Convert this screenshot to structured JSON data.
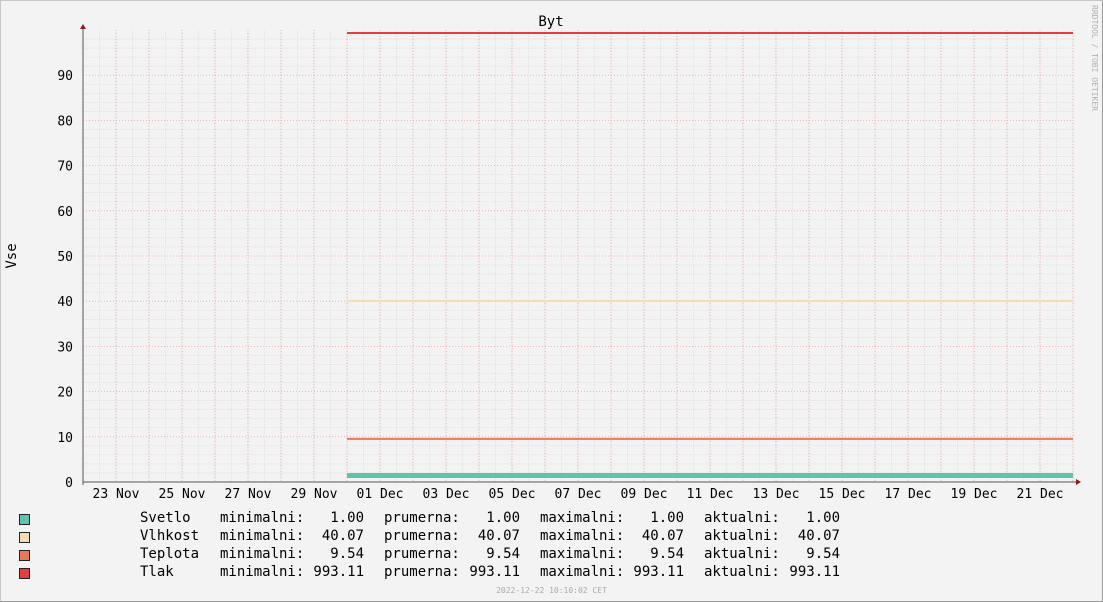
{
  "chart_data": {
    "type": "line",
    "title": "Byt",
    "ylabel": "Vse",
    "xlabel": "",
    "ylim": [
      0,
      100
    ],
    "yticks": [
      0,
      10,
      20,
      30,
      40,
      50,
      60,
      70,
      80,
      90
    ],
    "xlim": [
      "2022-11-22",
      "2022-12-22"
    ],
    "xticks": [
      {
        "date": "2022-11-23",
        "label": "23 Nov"
      },
      {
        "date": "2022-11-25",
        "label": "25 Nov"
      },
      {
        "date": "2022-11-27",
        "label": "27 Nov"
      },
      {
        "date": "2022-11-29",
        "label": "29 Nov"
      },
      {
        "date": "2022-12-01",
        "label": "01 Dec"
      },
      {
        "date": "2022-12-03",
        "label": "03 Dec"
      },
      {
        "date": "2022-12-05",
        "label": "05 Dec"
      },
      {
        "date": "2022-12-07",
        "label": "07 Dec"
      },
      {
        "date": "2022-12-09",
        "label": "09 Dec"
      },
      {
        "date": "2022-12-11",
        "label": "11 Dec"
      },
      {
        "date": "2022-12-13",
        "label": "13 Dec"
      },
      {
        "date": "2022-12-15",
        "label": "15 Dec"
      },
      {
        "date": "2022-12-17",
        "label": "17 Dec"
      },
      {
        "date": "2022-12-19",
        "label": "19 Dec"
      },
      {
        "date": "2022-12-21",
        "label": "21 Dec"
      }
    ],
    "grid": true,
    "series": [
      {
        "name": "Svetlo",
        "color": "#5fc3ad",
        "x": [
          "2022-11-30",
          "2022-12-22"
        ],
        "values": [
          1.0,
          1.0
        ],
        "minimalni": "1.00",
        "prumerna": "1.00",
        "maximalni": "1.00",
        "aktualni": "1.00"
      },
      {
        "name": "Vlhkost",
        "color": "#f5dcb4",
        "x": [
          "2022-11-30",
          "2022-12-22"
        ],
        "values": [
          40.07,
          40.07
        ],
        "minimalni": "40.07",
        "prumerna": "40.07",
        "maximalni": "40.07",
        "aktualni": "40.07"
      },
      {
        "name": "Teplota",
        "color": "#e47a56",
        "x": [
          "2022-11-30",
          "2022-12-22"
        ],
        "values": [
          9.54,
          9.54
        ],
        "minimalni": "9.54",
        "prumerna": "9.54",
        "maximalni": "9.54",
        "aktualni": "9.54"
      },
      {
        "name": "Tlak",
        "color": "#e53e3e",
        "x": [
          "2022-11-30",
          "2022-12-22"
        ],
        "values": [
          993.11,
          993.11
        ],
        "minimalni": "993.11",
        "prumerna": "993.11",
        "maximalni": "993.11",
        "aktualni": "993.11"
      }
    ]
  },
  "legend_labels": {
    "minimalni": "minimalni:",
    "prumerna": "prumerna:",
    "maximalni": "maximalni:",
    "aktualni": "aktualni:"
  },
  "footer": "2022-12-22 10:10:02 CET",
  "credit": "RRDTOOL / TOBI OETIKER",
  "colors": {
    "background": "#f3f3f3",
    "major_grid": "#e8a8a8",
    "minor_grid": "#d8d8d8",
    "axis": "#8a1c1c"
  }
}
